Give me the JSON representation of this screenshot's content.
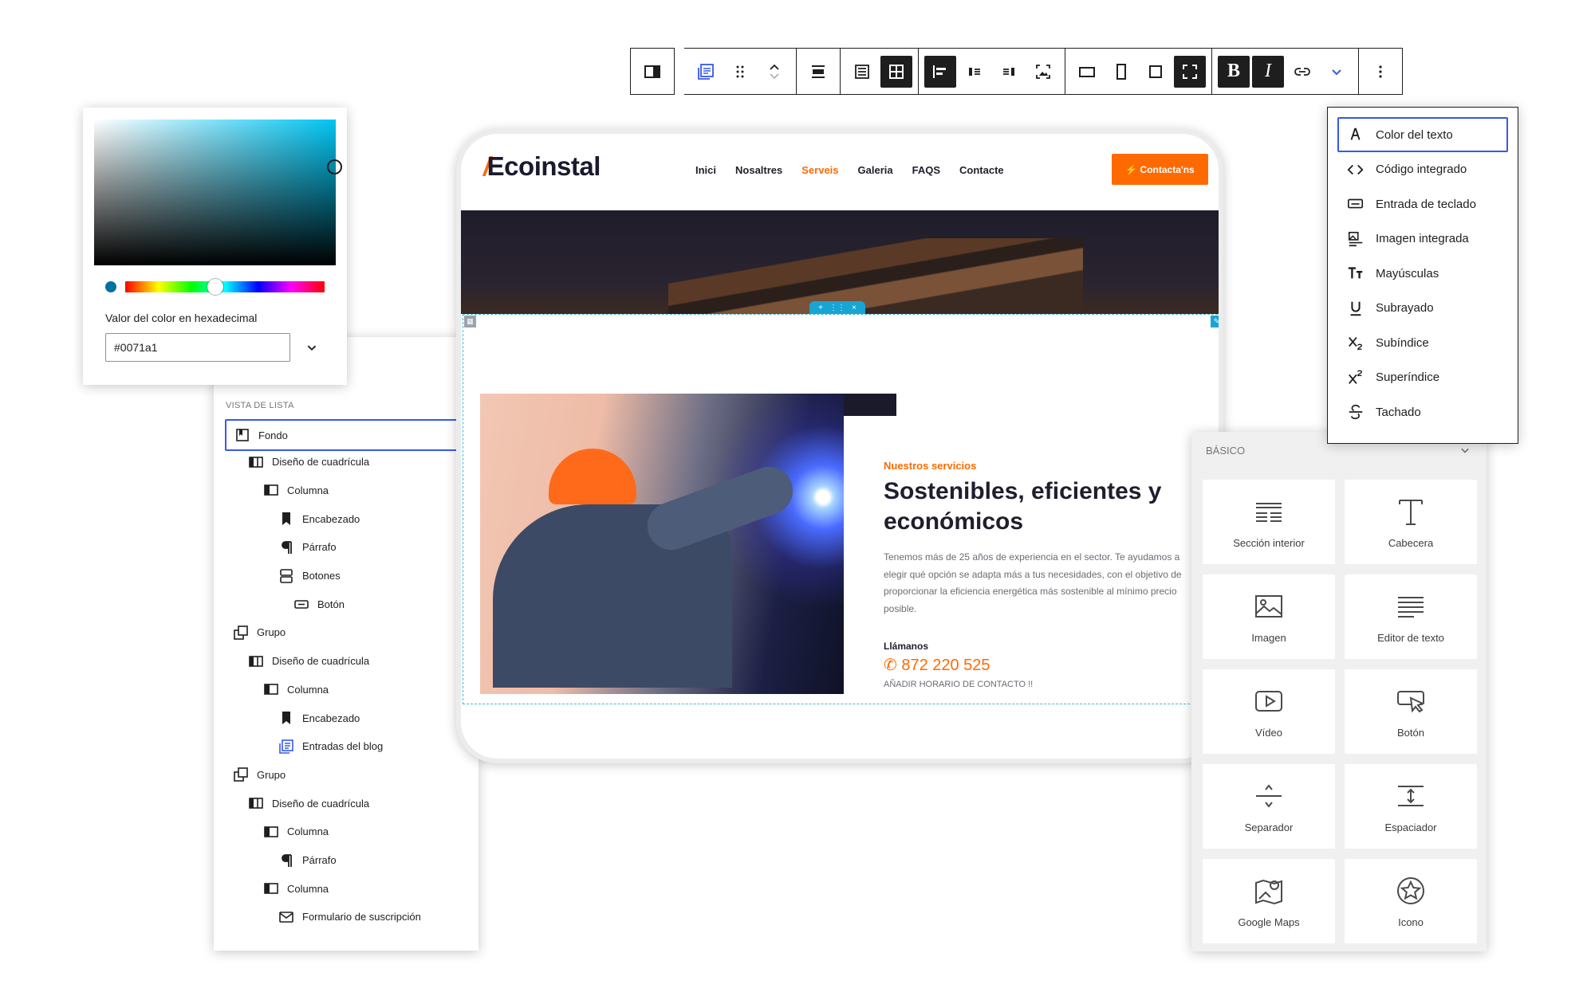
{
  "toolbar": {
    "buttons": [
      "sidebar",
      "blog",
      "drag",
      "move",
      "align-center",
      "list",
      "grid",
      "justify-left",
      "justify-middle",
      "justify-right",
      "image-fit",
      "box",
      "portrait",
      "square",
      "fullscreen",
      "bold",
      "italic",
      "link",
      "more-formatting",
      "options"
    ],
    "bold_label": "B",
    "italic_label": "I"
  },
  "picker": {
    "hex_label": "Valor del color en hexadecimal",
    "hex_value": "#0071a1",
    "swatch_color": "#0071a1",
    "hue_level": 0.45
  },
  "listview": {
    "heading": "VISTA DE LISTA",
    "items": [
      {
        "label": "Fondo",
        "icon": "bookmark-frame-icon"
      },
      {
        "label": "Diseño de cuadrícula",
        "icon": "columns-icon"
      },
      {
        "label": "Columna",
        "icon": "column-icon"
      },
      {
        "label": "Encabezado",
        "icon": "bookmark-icon"
      },
      {
        "label": "Párrafo",
        "icon": "pilcrow-icon"
      },
      {
        "label": "Botones",
        "icon": "buttons-icon"
      },
      {
        "label": "Botón",
        "icon": "button-icon"
      },
      {
        "label": "Grupo",
        "icon": "group-icon"
      },
      {
        "label": "Diseño de cuadrícula",
        "icon": "columns-icon"
      },
      {
        "label": "Columna",
        "icon": "column-icon"
      },
      {
        "label": "Encabezado",
        "icon": "bookmark-icon"
      },
      {
        "label": "Entradas del blog",
        "icon": "blog-icon"
      },
      {
        "label": "Grupo",
        "icon": "group-icon"
      },
      {
        "label": "Diseño de cuadrícula",
        "icon": "columns-icon"
      },
      {
        "label": "Columna",
        "icon": "column-icon"
      },
      {
        "label": "Párrafo",
        "icon": "pilcrow-icon"
      },
      {
        "label": "Columna",
        "icon": "column-icon"
      },
      {
        "label": "Formulario de suscripción",
        "icon": "envelope-icon"
      }
    ]
  },
  "site": {
    "logo": "Ecoinstal",
    "nav": [
      "Inici",
      "Nosaltres",
      "Serveis",
      "Galeria",
      "FAQS",
      "Contacte"
    ],
    "active_nav": "Serveis",
    "cta": "⚡ Contacta'ns",
    "kicker": "Nuestros servicios",
    "title": "Sostenibles, eficientes y económicos",
    "body": "Tenemos más de 25 años de experiencia en el sector. Te ayudamos a elegir qué opción se adapta más a tus necesidades, con el objetivo de proporcionar la eficiencia energética más sostenible al mínimo precio posible.",
    "call_label": "Llámanos",
    "phone": "872 220 525",
    "hours": "AÑADIR HORARIO DE CONTACTO !!",
    "accent": "#ff6a00"
  },
  "blocks": {
    "heading": "BÁSICO",
    "items": [
      {
        "label": "Sección interior",
        "icon": "section-icon"
      },
      {
        "label": "Cabecera",
        "icon": "heading-icon"
      },
      {
        "label": "Imagen",
        "icon": "image-icon"
      },
      {
        "label": "Editor de texto",
        "icon": "text-editor-icon"
      },
      {
        "label": "Vídeo",
        "icon": "video-icon"
      },
      {
        "label": "Botón",
        "icon": "button-click-icon"
      },
      {
        "label": "Separador",
        "icon": "divider-icon"
      },
      {
        "label": "Espaciador",
        "icon": "spacer-icon"
      },
      {
        "label": "Google Maps",
        "icon": "map-icon"
      },
      {
        "label": "Icono",
        "icon": "star-icon"
      }
    ]
  },
  "format_menu": {
    "items": [
      {
        "label": "Color del texto",
        "icon": "text-color-icon"
      },
      {
        "label": "Código integrado",
        "icon": "code-icon"
      },
      {
        "label": "Entrada de teclado",
        "icon": "keyboard-icon"
      },
      {
        "label": "Imagen integrada",
        "icon": "inline-image-icon"
      },
      {
        "label": "Mayúsculas",
        "icon": "uppercase-icon"
      },
      {
        "label": "Subrayado",
        "icon": "underline-icon"
      },
      {
        "label": "Subíndice",
        "icon": "subscript-icon"
      },
      {
        "label": "Superíndice",
        "icon": "superscript-icon"
      },
      {
        "label": "Tachado",
        "icon": "strikethrough-icon"
      }
    ]
  },
  "colors": {
    "selection": "#3858e9",
    "editor_dark": "#1e1e1e",
    "frame_blue": "#17a5d4"
  }
}
